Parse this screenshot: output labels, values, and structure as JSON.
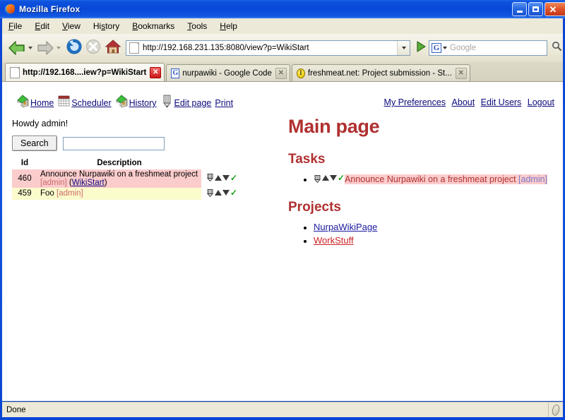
{
  "window": {
    "title": "Mozilla Firefox",
    "icon": "firefox-icon",
    "minimize_label": "",
    "maximize_label": "",
    "close_label": "✕"
  },
  "menubar": {
    "items": [
      {
        "label": "File",
        "accel": "F"
      },
      {
        "label": "Edit",
        "accel": "E"
      },
      {
        "label": "View",
        "accel": "V"
      },
      {
        "label": "History",
        "accel": "s"
      },
      {
        "label": "Bookmarks",
        "accel": "B"
      },
      {
        "label": "Tools",
        "accel": "T"
      },
      {
        "label": "Help",
        "accel": "H"
      }
    ]
  },
  "toolbar": {
    "back_icon": "back-arrow-icon",
    "forward_icon": "forward-arrow-icon",
    "reload_icon": "reload-icon",
    "stop_icon": "stop-icon",
    "home_icon": "home-icon",
    "url": "http://192.168.231.135:8080/view?p=WikiStart",
    "go_icon": "go-icon",
    "search_engine": "G",
    "search_placeholder": "Google",
    "search_value": "",
    "magnifier_icon": "magnifier-icon"
  },
  "tabs": [
    {
      "title": "http://192.168....iew?p=WikiStart",
      "favicon": "page-icon",
      "active": true,
      "close_label": "✕"
    },
    {
      "title": "nurpawiki - Google Code",
      "favicon": "google-icon",
      "active": false,
      "close_label": "✕"
    },
    {
      "title": "freshmeat.net: Project submission - St...",
      "favicon": "freshmeat-icon",
      "active": false,
      "close_label": "✕"
    }
  ],
  "page": {
    "nav_left": [
      {
        "label": "Home",
        "icon": "house-icon"
      },
      {
        "label": "Scheduler",
        "icon": "calendar-icon"
      },
      {
        "label": "History",
        "icon": "house-icon"
      },
      {
        "label": "Edit page",
        "icon": "pencil-icon"
      },
      {
        "label": "Print",
        "icon": ""
      }
    ],
    "nav_right": [
      "My Preferences",
      "About",
      "Edit Users",
      "Logout"
    ],
    "greeting": "Howdy admin!",
    "search_button": "Search",
    "search_input_value": "",
    "search_input_placeholder": "",
    "task_table": {
      "headers": [
        "Id",
        "Description"
      ],
      "rows": [
        {
          "id": "460",
          "desc_text": "Announce Nurpawiki on a freshmeat project ",
          "user": "[admin]",
          "paren_open": " (",
          "wiki_link": "WikiStart",
          "paren_close": ")",
          "priority": "prio1",
          "actions": [
            "edit-icon",
            "up-icon",
            "down-icon",
            "check-icon"
          ]
        },
        {
          "id": "459",
          "desc_text": "Foo ",
          "user": "[admin]",
          "paren_open": "",
          "wiki_link": "",
          "paren_close": "",
          "priority": "prio2",
          "actions": [
            "edit-icon",
            "up-icon",
            "down-icon",
            "check-icon"
          ]
        }
      ]
    },
    "main_title": "Main page",
    "tasks_heading": "Tasks",
    "tasks_items": [
      {
        "text": "Announce Nurpawiki on a freshmeat project ",
        "user": "[admin]",
        "actions": [
          "edit-icon",
          "up-icon",
          "down-icon",
          "check-icon"
        ]
      }
    ],
    "projects_heading": "Projects",
    "projects_items": [
      {
        "label": "NurpaWikiPage",
        "style": "blue"
      },
      {
        "label": "WorkStuff",
        "style": "red"
      }
    ]
  },
  "statusbar": {
    "text": "Done",
    "resize_icon": "resize-grip-icon"
  },
  "colors": {
    "title_bar": "#0848d8",
    "heading": "#b03030",
    "link": "#0a0a7a",
    "prio1_row": "#fbcccc",
    "prio2_row": "#fbfbcc",
    "chrome": "#ece9d8"
  }
}
